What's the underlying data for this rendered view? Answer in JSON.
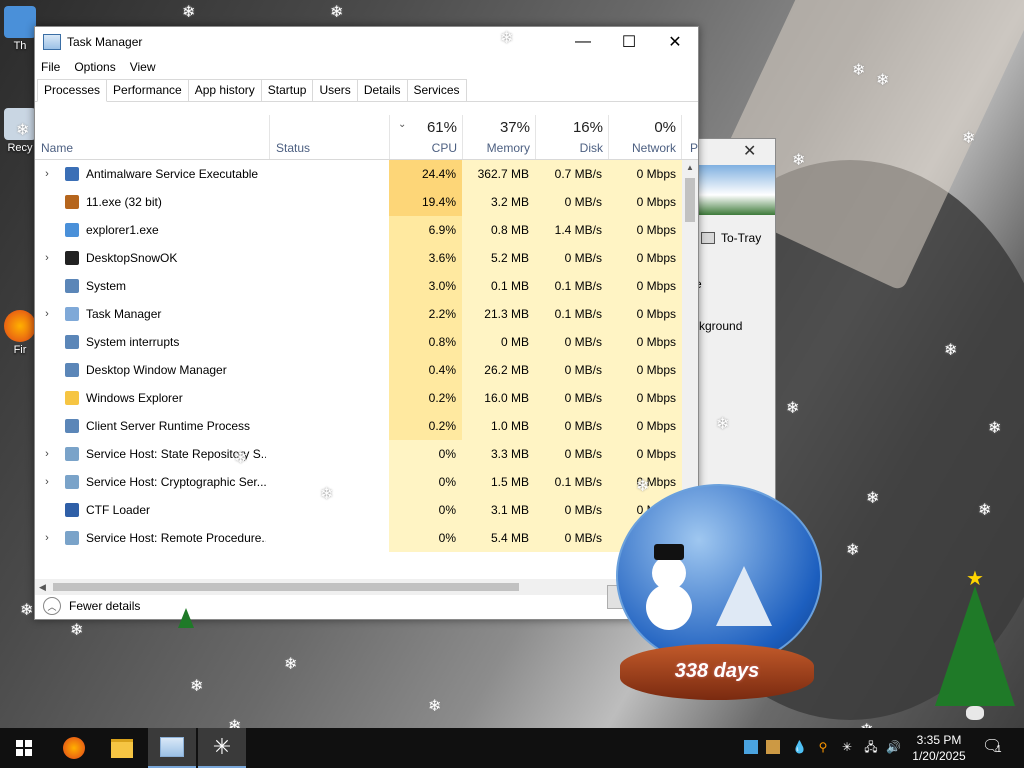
{
  "desktop": {
    "icons": [
      {
        "label": "Th",
        "icon": "user-icon"
      },
      {
        "label": "Recy",
        "icon": "recycle-bin-icon"
      },
      {
        "label": "Fir",
        "icon": "firefox-icon"
      }
    ]
  },
  "task_manager": {
    "title": "Task Manager",
    "window_controls": {
      "minimize": "—",
      "maximize": "☐",
      "close": "✕"
    },
    "menu": [
      "File",
      "Options",
      "View"
    ],
    "tabs": [
      "Processes",
      "Performance",
      "App history",
      "Startup",
      "Users",
      "Details",
      "Services"
    ],
    "active_tab": "Processes",
    "columns": {
      "name": "Name",
      "status": "Status",
      "cpu": {
        "label": "CPU",
        "pct": "61%"
      },
      "memory": {
        "label": "Memory",
        "pct": "37%"
      },
      "disk": {
        "label": "Disk",
        "pct": "16%"
      },
      "network": {
        "label": "Network",
        "pct": "0%"
      },
      "extra": "P"
    },
    "processes": [
      {
        "expand": true,
        "icon": "antimalware-icon",
        "name": "Antimalware Service Executable",
        "cpu": "24.4%",
        "memory": "362.7 MB",
        "disk": "0.7 MB/s",
        "network": "0 Mbps"
      },
      {
        "expand": false,
        "icon": "app-icon",
        "name": "11.exe (32 bit)",
        "cpu": "19.4%",
        "memory": "3.2 MB",
        "disk": "0 MB/s",
        "network": "0 Mbps"
      },
      {
        "expand": false,
        "icon": "window-icon",
        "name": "explorer1.exe",
        "cpu": "6.9%",
        "memory": "0.8 MB",
        "disk": "1.4 MB/s",
        "network": "0 Mbps"
      },
      {
        "expand": true,
        "icon": "snowflake-icon",
        "name": "DesktopSnowOK",
        "cpu": "3.6%",
        "memory": "5.2 MB",
        "disk": "0 MB/s",
        "network": "0 Mbps"
      },
      {
        "expand": false,
        "icon": "system-icon",
        "name": "System",
        "cpu": "3.0%",
        "memory": "0.1 MB",
        "disk": "0.1 MB/s",
        "network": "0 Mbps"
      },
      {
        "expand": true,
        "icon": "task-manager-icon",
        "name": "Task Manager",
        "cpu": "2.2%",
        "memory": "21.3 MB",
        "disk": "0.1 MB/s",
        "network": "0 Mbps"
      },
      {
        "expand": false,
        "icon": "system-icon",
        "name": "System interrupts",
        "cpu": "0.8%",
        "memory": "0 MB",
        "disk": "0 MB/s",
        "network": "0 Mbps"
      },
      {
        "expand": false,
        "icon": "dwm-icon",
        "name": "Desktop Window Manager",
        "cpu": "0.4%",
        "memory": "26.2 MB",
        "disk": "0 MB/s",
        "network": "0 Mbps"
      },
      {
        "expand": false,
        "icon": "folder-icon",
        "name": "Windows Explorer",
        "cpu": "0.2%",
        "memory": "16.0 MB",
        "disk": "0 MB/s",
        "network": "0 Mbps"
      },
      {
        "expand": false,
        "icon": "system-icon",
        "name": "Client Server Runtime Process",
        "cpu": "0.2%",
        "memory": "1.0 MB",
        "disk": "0 MB/s",
        "network": "0 Mbps"
      },
      {
        "expand": true,
        "icon": "gear-icon",
        "name": "Service Host: State Repository S...",
        "cpu": "0%",
        "memory": "3.3 MB",
        "disk": "0 MB/s",
        "network": "0 Mbps"
      },
      {
        "expand": true,
        "icon": "gear-icon",
        "name": "Service Host: Cryptographic Ser...",
        "cpu": "0%",
        "memory": "1.5 MB",
        "disk": "0.1 MB/s",
        "network": "0 Mbps"
      },
      {
        "expand": false,
        "icon": "pen-icon",
        "name": "CTF Loader",
        "cpu": "0%",
        "memory": "3.1 MB",
        "disk": "0 MB/s",
        "network": "0 Mbps"
      },
      {
        "expand": true,
        "icon": "gear-icon",
        "name": "Service Host: Remote Procedure...",
        "cpu": "0%",
        "memory": "5.4 MB",
        "disk": "0 MB/s",
        "network": "0 Mbps"
      }
    ],
    "footer": {
      "fewer_details": "Fewer details"
    }
  },
  "back_window": {
    "to_tray": "To-Tray",
    "text1": "e",
    "text2": "ckground"
  },
  "snow_globe": {
    "days": "338 days"
  },
  "taskbar": {
    "apps": [
      "start-icon",
      "firefox-icon",
      "file-explorer-icon",
      "task-manager-icon",
      "desktop-snow-icon"
    ],
    "clock": {
      "time": "3:35 PM",
      "date": "1/20/2025"
    },
    "notifications": "1"
  },
  "colors": {
    "cpu_high": "#fdd678",
    "cpu_mid": "#ffe9a0",
    "cpu_low": "#fff4c4",
    "accent": "#7aa7d9"
  }
}
